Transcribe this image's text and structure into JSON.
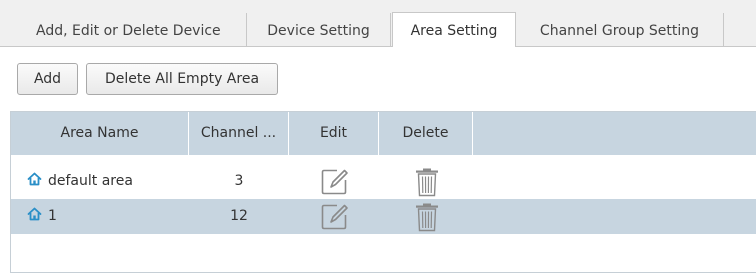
{
  "tabs": [
    {
      "label": "Add, Edit or Delete Device"
    },
    {
      "label": "Device Setting"
    },
    {
      "label": "Area Setting"
    },
    {
      "label": "Channel Group Setting"
    }
  ],
  "toolbar": {
    "add_label": "Add",
    "delete_all_label": "Delete All Empty Area"
  },
  "table": {
    "columns": [
      "Area Name",
      "Channel ...",
      "Edit",
      "Delete"
    ],
    "rows": [
      {
        "area_name": "default area",
        "channels": "3"
      },
      {
        "area_name": "1",
        "channels": "12"
      }
    ]
  },
  "colors": {
    "header_bg": "#c7d5e0",
    "selected_row_bg": "#c7d5e0",
    "home_icon": "#2a8fc7"
  },
  "icons": [
    "home-icon",
    "edit-icon",
    "trash-icon"
  ]
}
